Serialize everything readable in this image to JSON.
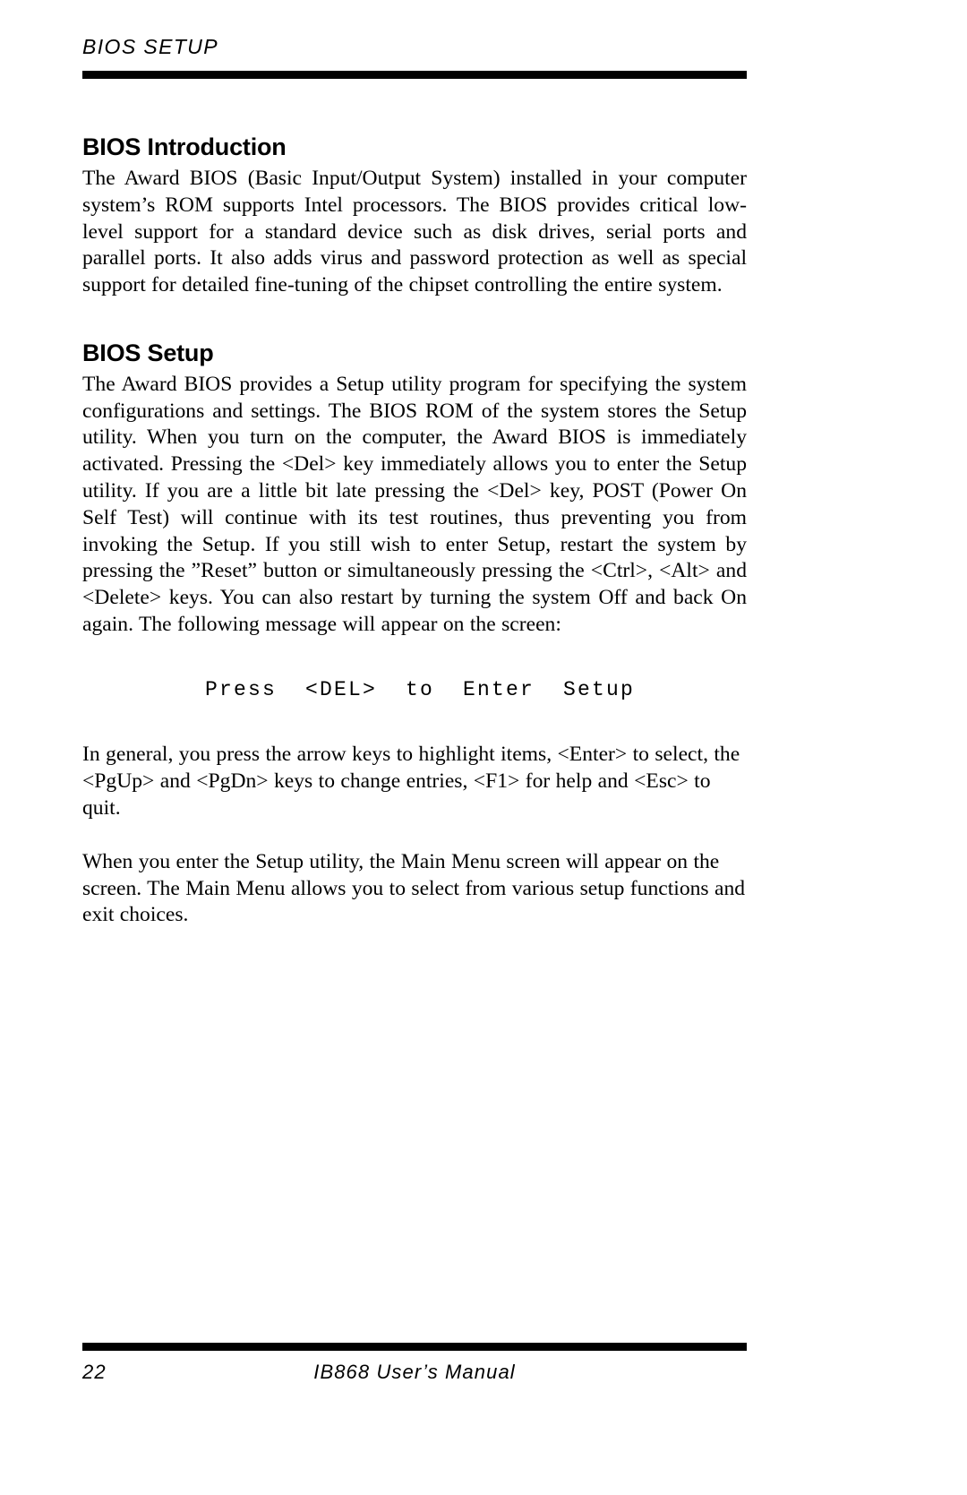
{
  "page": {
    "running_head": "BIOS SETUP",
    "page_number": "22",
    "manual_title": "IB868 User’s Manual"
  },
  "sections": [
    {
      "heading": "BIOS Introduction",
      "paragraph": "The Award BIOS (Basic Input/Output System) installed in your computer system’s ROM supports Intel processors. The BIOS provides critical low-level support for a standard device such as disk drives, serial ports and parallel ports. It also adds virus and password protection as well as special support for detailed fine-tuning of the chipset controlling the entire system."
    },
    {
      "heading": "BIOS Setup",
      "paragraph": "The Award BIOS provides a Setup utility program for specifying the system configurations and settings. The BIOS ROM of the system stores the Setup utility. When you turn on the computer, the Award BIOS is immediately activated. Pressing the <Del> key immediately allows you to enter the Setup utility. If you are a little bit late pressing the <Del> key, POST (Power On Self Test) will continue with its test routines, thus preventing you from invoking the Setup. If you still wish to enter Setup, restart the system by pressing the ”Reset” button or simultaneously pressing the <Ctrl>, <Alt> and <Delete> keys. You can also restart by turning the system Off and back On again. The following message will appear on the screen:"
    }
  ],
  "code_line": "Press  <DEL>  to  Enter  Setup",
  "paragraphs_after": [
    "In general, you press the arrow keys to highlight items, <Enter> to select, the <PgUp> and <PgDn> keys to change entries, <F1> for help and <Esc> to quit.",
    "When you enter the Setup utility, the Main Menu screen will appear on the screen. The Main Menu allows you to select from various setup functions and exit choices."
  ]
}
